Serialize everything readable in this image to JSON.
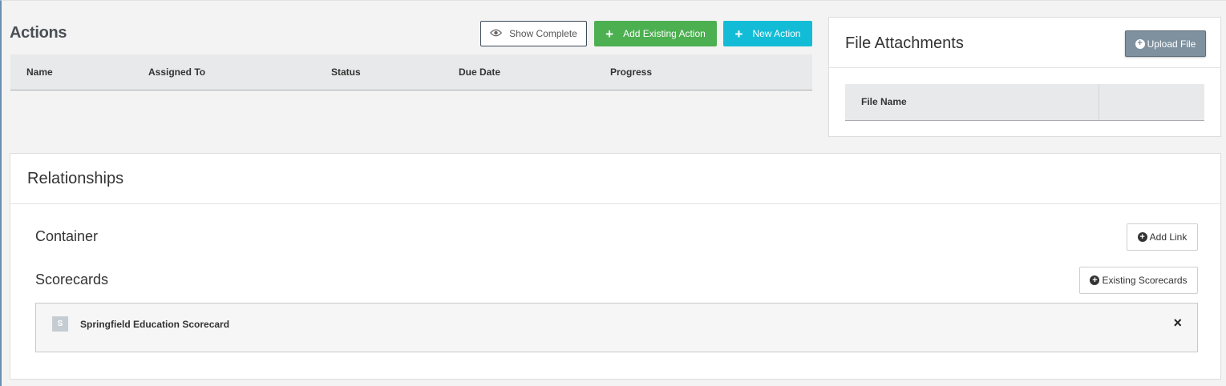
{
  "actions": {
    "title": "Actions",
    "buttons": {
      "show_complete": "Show Complete",
      "add_existing_action": "Add Existing Action",
      "new_action": "New Action"
    },
    "columns": [
      "Name",
      "Assigned To",
      "Status",
      "Due Date",
      "Progress"
    ],
    "rows": []
  },
  "file_attachments": {
    "title": "File Attachments",
    "upload_button": "Upload File",
    "columns": [
      "File Name",
      ""
    ],
    "rows": []
  },
  "relationships": {
    "title": "Relationships",
    "container": {
      "label": "Container",
      "button": "Add Link"
    },
    "scorecards": {
      "label": "Scorecards",
      "button": "Existing Scorecards",
      "items": [
        {
          "badge": "S",
          "name": "Springfield Education Scorecard"
        }
      ]
    }
  },
  "colors": {
    "green_button": "#4caf50",
    "cyan_button": "#13bcd6",
    "upload_button": "#7f919f",
    "header_row": "#e8e9ea"
  },
  "icons": {
    "show_complete": "eye-icon",
    "add": "plus-icon",
    "upload": "plus-circle-icon",
    "remove": "close-icon"
  }
}
